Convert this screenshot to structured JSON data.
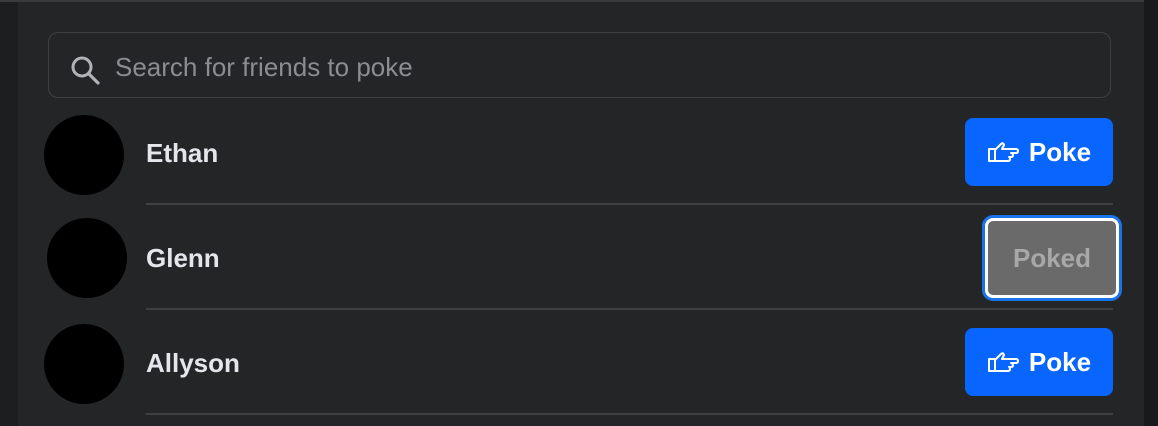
{
  "search": {
    "placeholder": "Search for friends to poke",
    "icon": "search-icon"
  },
  "friends": [
    {
      "name": "Ethan",
      "action_label": "Poke",
      "action_state": "poke",
      "icon": "hand-point-icon"
    },
    {
      "name": "Glenn",
      "action_label": "Poked",
      "action_state": "poked"
    },
    {
      "name": "Allyson",
      "action_label": "Poke",
      "action_state": "poke",
      "icon": "hand-point-icon"
    }
  ],
  "colors": {
    "background": "#242527",
    "accent": "#0866ff",
    "poked_button": "#6a6a6a",
    "text": "#e4e6eb",
    "placeholder": "#8a8d91"
  }
}
